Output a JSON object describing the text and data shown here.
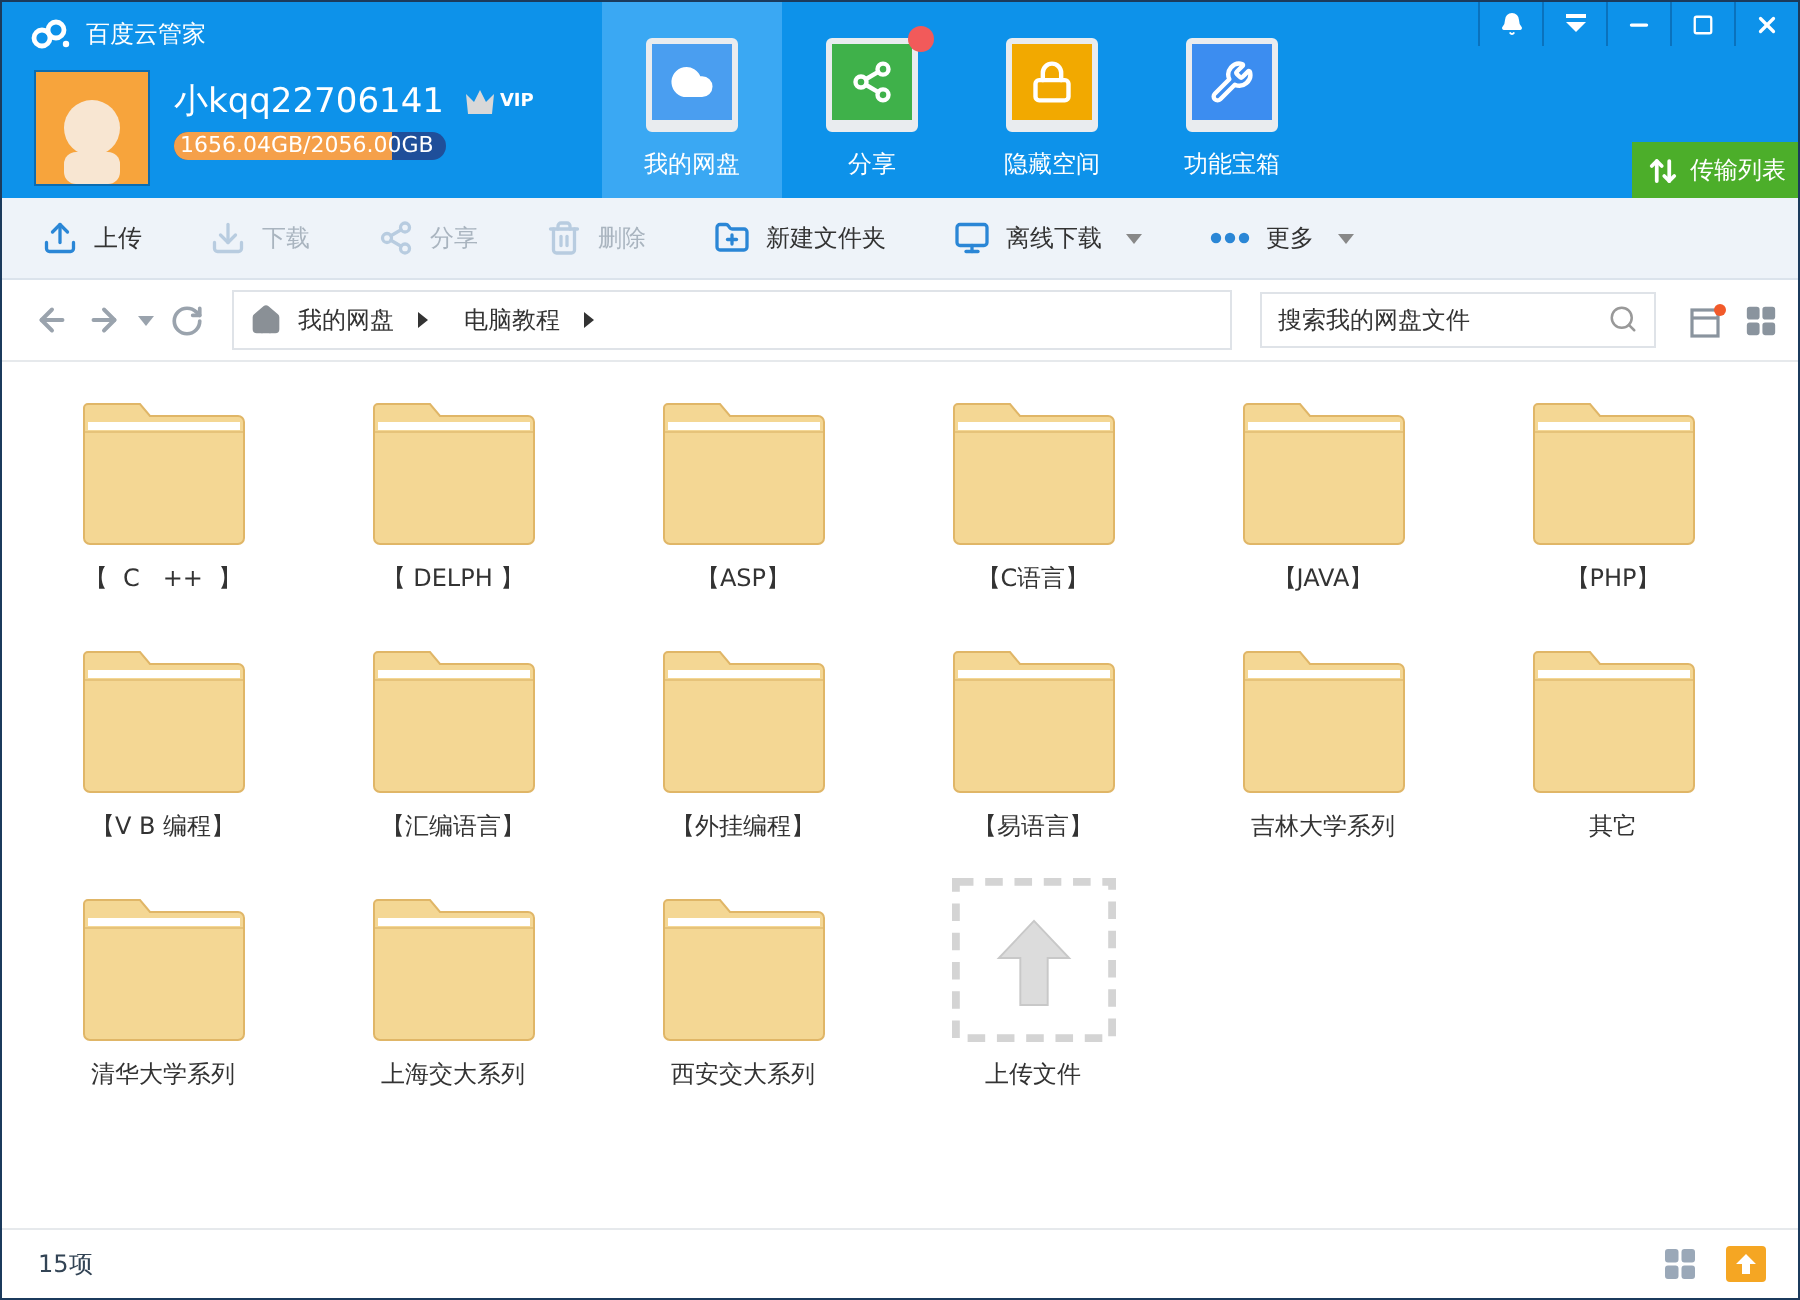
{
  "app": {
    "title": "百度云管家"
  },
  "user": {
    "name": "小kqq22706141",
    "vip_label": "VIP",
    "storage": {
      "text": "1656.04GB/2056.00GB",
      "level": 0.805
    }
  },
  "nav_tabs": [
    {
      "label": "我的网盘",
      "kind": "disk",
      "selected": true,
      "notification": false
    },
    {
      "label": "分享",
      "kind": "share",
      "selected": false,
      "notification": true
    },
    {
      "label": "隐藏空间",
      "kind": "vault",
      "selected": false,
      "notification": false
    },
    {
      "label": "功能宝箱",
      "kind": "tools",
      "selected": false,
      "notification": false
    }
  ],
  "transfer_button": "传输列表",
  "toolbar": [
    {
      "label": "上传",
      "kind": "upload",
      "disabled": false,
      "dropdown": false
    },
    {
      "label": "下载",
      "kind": "download",
      "disabled": true,
      "dropdown": false
    },
    {
      "label": "分享",
      "kind": "share",
      "disabled": true,
      "dropdown": false
    },
    {
      "label": "删除",
      "kind": "delete",
      "disabled": true,
      "dropdown": false
    },
    {
      "label": "新建文件夹",
      "kind": "newfolder",
      "disabled": false,
      "dropdown": false
    },
    {
      "label": "离线下载",
      "kind": "offline",
      "disabled": false,
      "dropdown": true
    },
    {
      "label": "更多",
      "kind": "more",
      "disabled": false,
      "dropdown": true
    }
  ],
  "breadcrumb": [
    "我的网盘",
    "电脑教程"
  ],
  "search": {
    "placeholder": "搜索我的网盘文件"
  },
  "files": [
    {
      "name": "【  C   ++  】",
      "kind": "folder"
    },
    {
      "name": "【 DELPH 】",
      "kind": "folder"
    },
    {
      "name": "【ASP】",
      "kind": "folder"
    },
    {
      "name": "【C语言】",
      "kind": "folder"
    },
    {
      "name": "【JAVA】",
      "kind": "folder"
    },
    {
      "name": "【PHP】",
      "kind": "folder"
    },
    {
      "name": "【V B 编程】",
      "kind": "folder"
    },
    {
      "name": "【汇编语言】",
      "kind": "folder"
    },
    {
      "name": "【外挂编程】",
      "kind": "folder"
    },
    {
      "name": "【易语言】",
      "kind": "folder"
    },
    {
      "name": "吉林大学系列",
      "kind": "folder"
    },
    {
      "name": "其它",
      "kind": "folder"
    },
    {
      "name": "清华大学系列",
      "kind": "folder"
    },
    {
      "name": "上海交大系列",
      "kind": "folder"
    },
    {
      "name": "西安交大系列",
      "kind": "folder"
    },
    {
      "name": "上传文件",
      "kind": "upload"
    }
  ],
  "status_bar": {
    "count": "15项"
  }
}
